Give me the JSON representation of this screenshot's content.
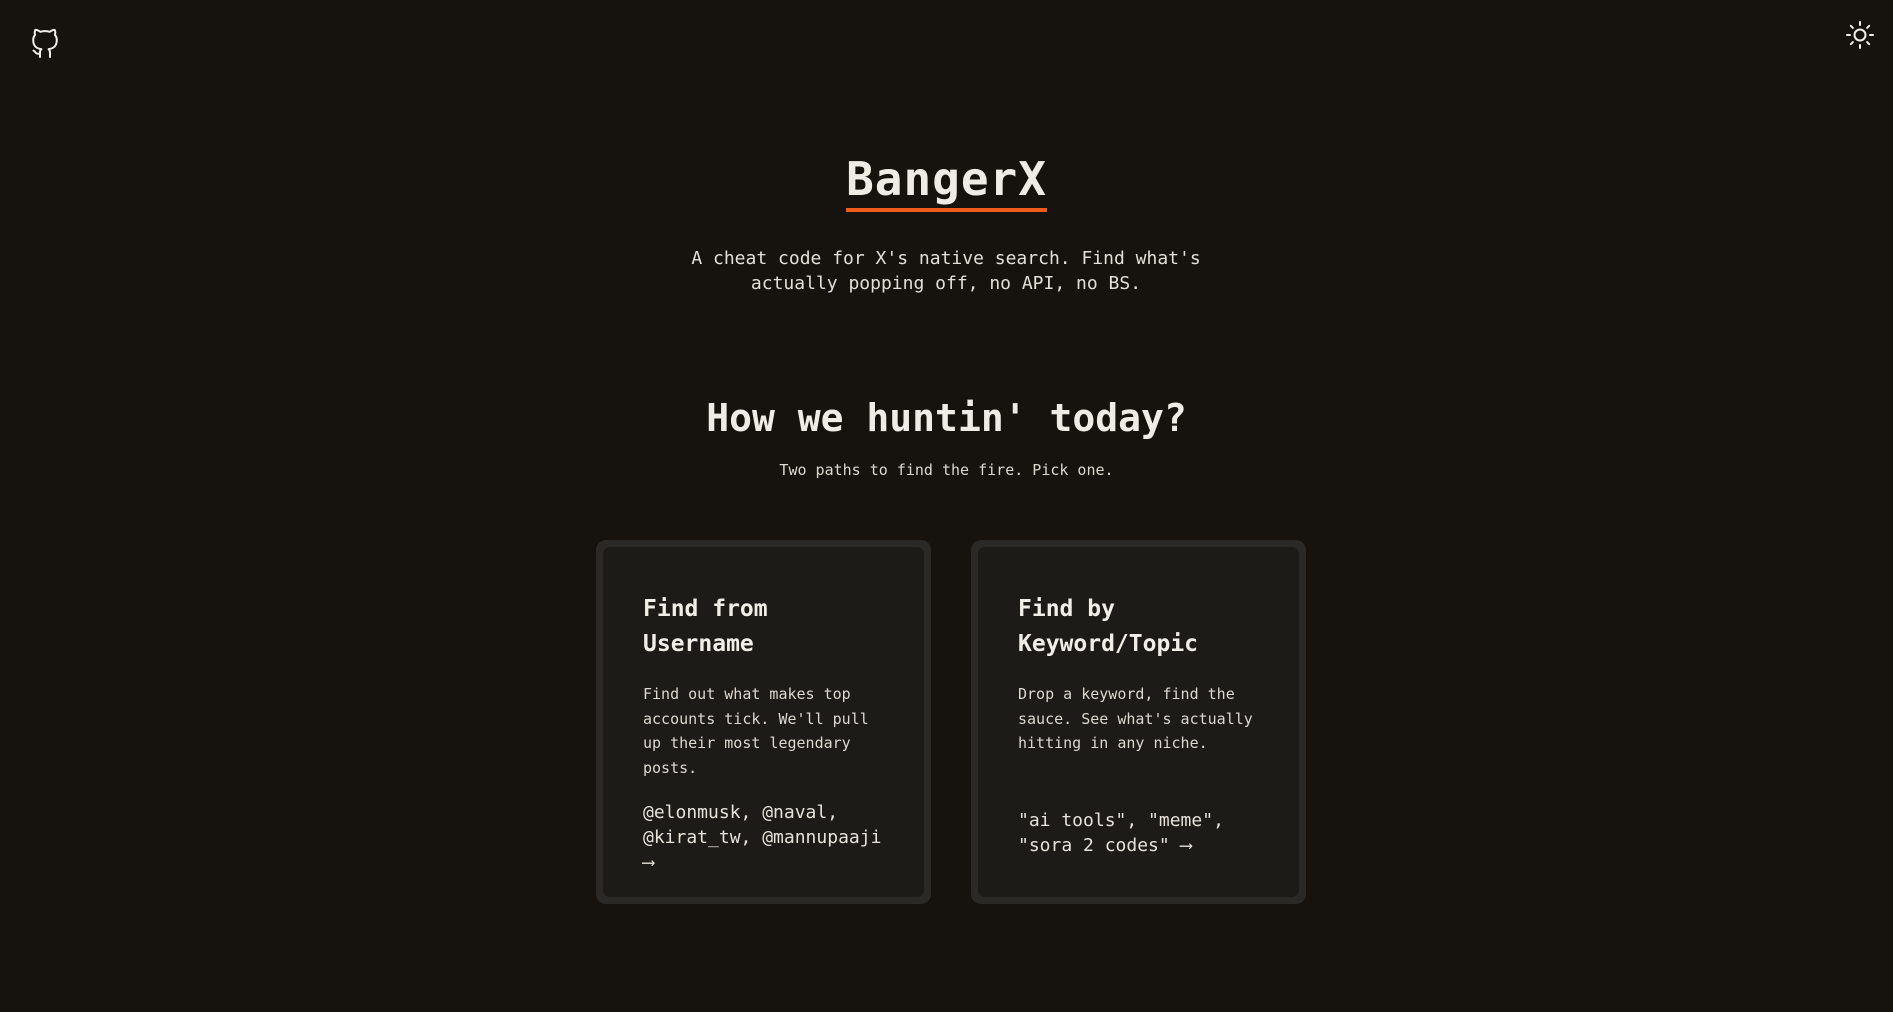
{
  "header": {
    "github_icon": "github-icon",
    "theme_icon": "sun-icon"
  },
  "hero": {
    "title": "BangerX",
    "tagline": "A cheat code for X's native search. Find what's actually popping off, no API, no BS."
  },
  "section": {
    "heading": "How we huntin' today?",
    "subheading": "Two paths to find the fire. Pick one."
  },
  "cards": [
    {
      "title": "Find from Username",
      "description": "Find out what makes top accounts tick. We'll pull up their most legendary posts.",
      "example": "@elonmusk, @naval, @kirat_tw, @mannupaaji",
      "arrow": "⟶"
    },
    {
      "title": "Find by Keyword/Topic",
      "description": "Drop a keyword, find the sauce. See what's actually hitting in any niche.",
      "example": "\"ai tools\", \"meme\", \"sora 2 codes\"",
      "arrow": "⟶"
    }
  ],
  "colors": {
    "background": "#16130e",
    "accent": "#f05a1a",
    "card_border": "#2a2926",
    "card_bg": "#1c1b18"
  }
}
